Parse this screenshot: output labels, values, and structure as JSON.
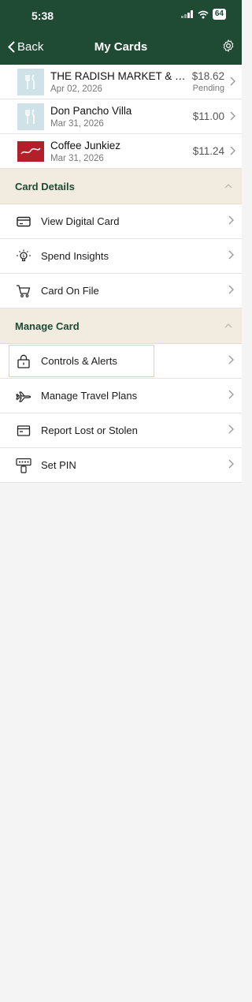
{
  "status_bar": {
    "time": "5:38",
    "battery": "64"
  },
  "nav": {
    "back_label": "Back",
    "title": "My Cards"
  },
  "transactions": [
    {
      "name": "THE RADISH MARKET & CA...",
      "date": "Apr 02, 2026",
      "amount": "$18.62",
      "status": "Pending",
      "logo": "fork-knife-icon"
    },
    {
      "name": "Don Pancho Villa",
      "date": "Mar 31, 2026",
      "amount": "$11.00",
      "status": "",
      "logo": "fork-knife-icon"
    },
    {
      "name": "Coffee Junkiez",
      "date": "Mar 31, 2026",
      "amount": "$11.24",
      "status": "",
      "logo": "coffee-junkiez-logo"
    }
  ],
  "card_details": {
    "header": "Card Details",
    "items": [
      {
        "label": "View Digital Card",
        "icon": "card-icon"
      },
      {
        "label": "Spend Insights",
        "icon": "lightbulb-icon"
      },
      {
        "label": "Card On File",
        "icon": "cart-icon"
      }
    ]
  },
  "manage_card": {
    "header": "Manage Card",
    "items": [
      {
        "label": "Controls & Alerts",
        "icon": "lock-icon"
      },
      {
        "label": "Manage Travel Plans",
        "icon": "airplane-icon"
      },
      {
        "label": "Report Lost or Stolen",
        "icon": "wallet-icon"
      },
      {
        "label": "Set PIN",
        "icon": "pin-keypad-icon"
      }
    ]
  },
  "colors": {
    "header_bg": "#1f4a34",
    "section_bg": "#f1ebe0",
    "section_text": "#1f4a34",
    "highlight": "#e8d98a"
  }
}
